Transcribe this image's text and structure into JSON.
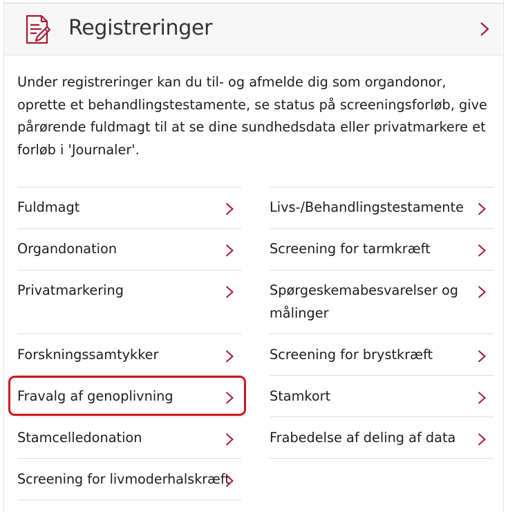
{
  "header": {
    "title": "Registreringer",
    "icon": "document-edit-icon",
    "chevron_icon": "chevron-right-icon"
  },
  "intro": "Under registreringer kan du til- og afmelde dig som organdonor, oprette et behandlingstestamente, se status på screeningsforløb, give pårørende fuldmagt til at se dine sundhedsdata eller privatmarkere et forløb i 'Journaler'.",
  "left_links": [
    "Fuldmagt",
    "Organdonation",
    "Privatmarkering",
    "Forskningssamtykker",
    "Fravalg af genoplivning",
    "Stamcelledonation",
    "Screening for livmoderhalskræft"
  ],
  "right_links": [
    "Livs-/Behandlingstestamente",
    "Screening for tarmkræft",
    "Spørgeskemabesvarelser og målinger",
    "Screening for brystkræft",
    "Stamkort",
    "Frabedelse af deling af data"
  ],
  "highlighted_link": "Fravalg af genoplivning",
  "colors": {
    "accent": "#a6192e",
    "highlight_border": "#d2121b",
    "header_bg": "#f7f7f7",
    "separator": "#dcdcdc"
  }
}
